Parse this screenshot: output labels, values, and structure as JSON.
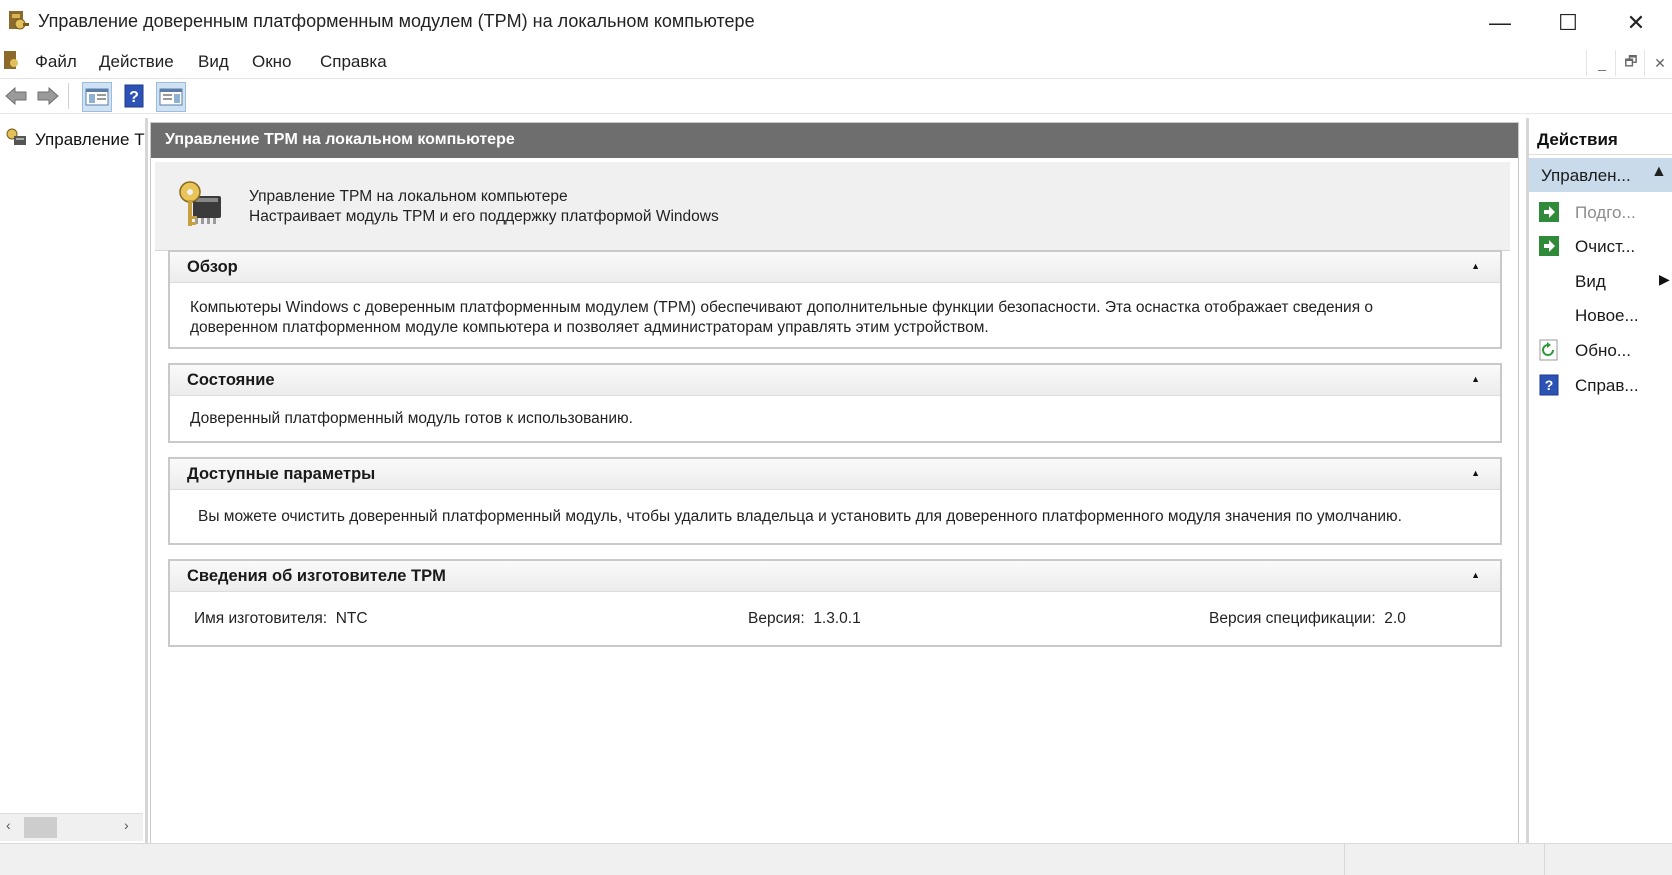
{
  "window": {
    "title": "Управление доверенным платформенным модулем (TPM) на локальном компьютере",
    "controls": {
      "minimize": "—",
      "maximize": "☐",
      "close": "✕"
    }
  },
  "menu": {
    "items": [
      "Файл",
      "Действие",
      "Вид",
      "Окно",
      "Справка"
    ],
    "mdi_controls": {
      "minimize": "_",
      "restore": "🗗",
      "close": "✕"
    }
  },
  "toolbar": {
    "icons": [
      "back-icon",
      "forward-icon",
      "show-hide-console-tree-icon",
      "help-icon",
      "show-hide-action-pane-icon"
    ]
  },
  "tree": {
    "root_label": "Управление T",
    "scroll": {
      "left": "‹",
      "right": "›"
    }
  },
  "center": {
    "header": "Управление TPM на локальном компьютере",
    "intro": {
      "title": "Управление TPM на локальном компьютере",
      "description": "Настраивает модуль TPM и его поддержку платформой Windows"
    },
    "sections": {
      "overview": {
        "title": "Обзор",
        "text_line1": "Компьютеры Windows с доверенным платформенным модулем (TPM) обеспечивают дополнительные функции безопасности. Эта оснастка отображает сведения о",
        "text_line2": "доверенном платформенном модуле компьютера и позволяет администраторам управлять этим устройством."
      },
      "status": {
        "title": "Состояние",
        "text": "Доверенный платформенный модуль готов к использованию."
      },
      "options": {
        "title": "Доступные параметры",
        "text": "Вы можете очистить доверенный платформенный модуль, чтобы удалить владельца и установить для доверенного платформенного модуля значения по умолчанию."
      },
      "manufacturer": {
        "title": "Сведения об изготовителе TPM",
        "name_label": "Имя изготовителя:",
        "name_value": "NTC",
        "version_label": "Версия:",
        "version_value": "1.3.0.1",
        "spec_label": "Версия спецификации:",
        "spec_value": "2.0"
      }
    }
  },
  "actions": {
    "header": "Действия",
    "group_label": "Управлен...",
    "items": [
      {
        "label": "Подго...",
        "icon": "green-arrow-icon",
        "disabled": true
      },
      {
        "label": "Очист...",
        "icon": "green-arrow-icon",
        "disabled": false
      },
      {
        "label": "Вид",
        "icon": "",
        "disabled": false,
        "submenu": true
      },
      {
        "label": "Новое...",
        "icon": "",
        "disabled": false
      },
      {
        "label": "Обно...",
        "icon": "refresh-icon",
        "disabled": false
      },
      {
        "label": "Справ...",
        "icon": "help-icon",
        "disabled": false
      }
    ]
  }
}
